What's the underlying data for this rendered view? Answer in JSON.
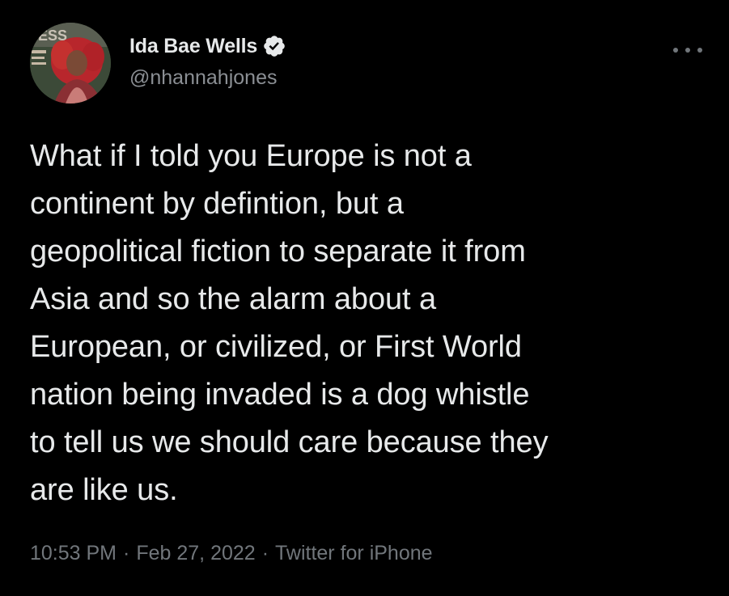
{
  "author": {
    "display_name": "Ida Bae Wells",
    "handle": "@nhannahjones",
    "verified": true,
    "avatar_icon": "profile-photo"
  },
  "tweet": {
    "text_lines": [
      "What if I told you Europe is not a",
      "continent by defintion, but a",
      "geopolitical fiction to separate it from",
      "Asia and so the alarm about a",
      "European, or civilized, or First World",
      "nation being invaded is a dog whistle",
      "to tell us we should care because they",
      "are like us."
    ]
  },
  "meta": {
    "time": "10:53 PM",
    "separator": "·",
    "date": "Feb 27, 2022",
    "source": "Twitter for iPhone"
  },
  "colors": {
    "background": "#000000",
    "text": "#e7e9ea",
    "secondary": "#71767b"
  }
}
